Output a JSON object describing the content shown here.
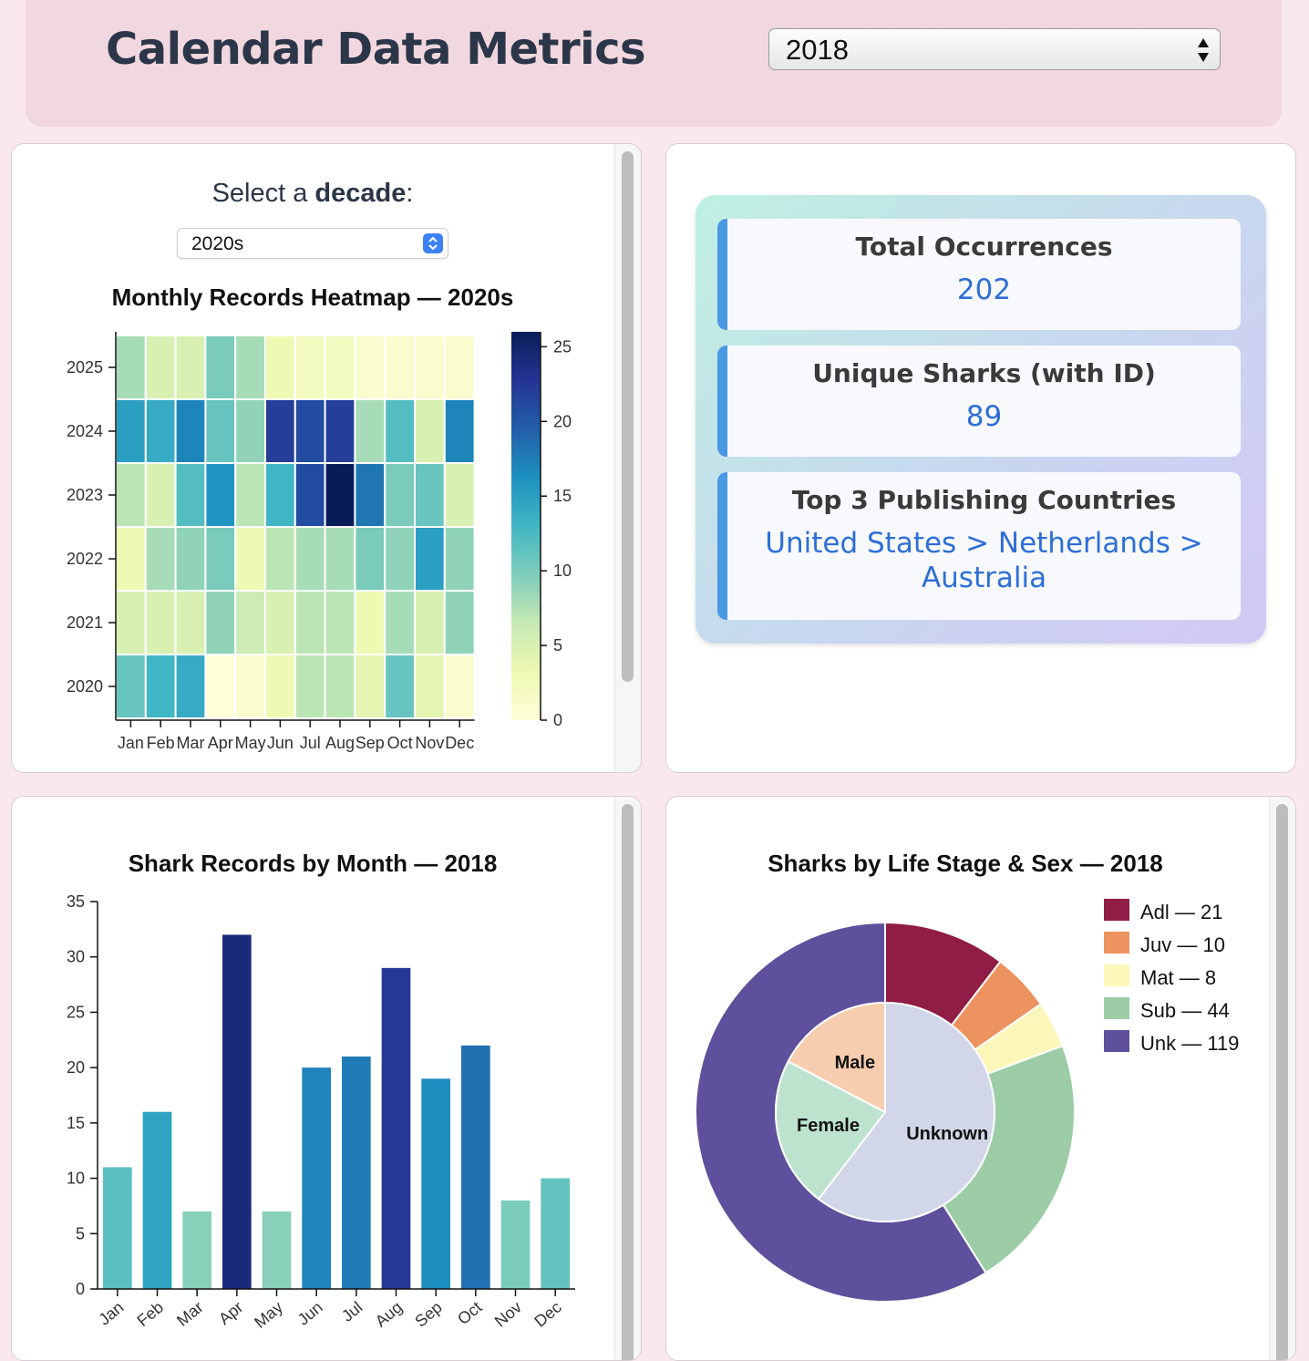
{
  "header": {
    "title": "Calendar Data Metrics",
    "year_select": {
      "value": "2018"
    }
  },
  "heatmap_panel": {
    "decade_label_prefix": "Select a ",
    "decade_label_bold": "decade",
    "decade_label_suffix": ":",
    "decade_select": {
      "value": "2020s"
    }
  },
  "metrics": {
    "total_occurrences": {
      "label": "Total Occurrences",
      "value": "202"
    },
    "unique_sharks": {
      "label": "Unique Sharks (with ID)",
      "value": "89"
    },
    "top_countries": {
      "label": "Top 3 Publishing Countries",
      "value_line1": "United States > Netherlands >",
      "value_line2": "Australia"
    }
  },
  "colors": {
    "accent_blue": "#4a97e4",
    "metric_value": "#2e6fd6",
    "header_bg": "#f1d7df",
    "page_bg": "#f9e8ee"
  },
  "chart_data": [
    {
      "type": "heatmap",
      "title": "Monthly Records Heatmap — 2020s",
      "x_categories": [
        "Jan",
        "Feb",
        "Mar",
        "Apr",
        "May",
        "Jun",
        "Jul",
        "Aug",
        "Sep",
        "Oct",
        "Nov",
        "Dec"
      ],
      "y_categories": [
        "2025",
        "2024",
        "2023",
        "2022",
        "2021",
        "2020"
      ],
      "values": [
        [
          8,
          5,
          5,
          10,
          8,
          3,
          2,
          2,
          1,
          1,
          1,
          1
        ],
        [
          15,
          14,
          17,
          11,
          9,
          22,
          21,
          22,
          8,
          12,
          5,
          17
        ],
        [
          7,
          5,
          12,
          16,
          7,
          13,
          21,
          26,
          18,
          10,
          11,
          5
        ],
        [
          3,
          8,
          9,
          10,
          3,
          7,
          8,
          8,
          10,
          9,
          15,
          9
        ],
        [
          5,
          5,
          5,
          9,
          6,
          5,
          7,
          7,
          3,
          8,
          5,
          9
        ],
        [
          11,
          13,
          14,
          0,
          1,
          3,
          7,
          7,
          4,
          11,
          4,
          1
        ]
      ],
      "colorscale_range": [
        0,
        26
      ],
      "colorbar_ticks": [
        0,
        5,
        10,
        15,
        20,
        25
      ]
    },
    {
      "type": "bar",
      "title": "Shark Records by Month — 2018",
      "categories": [
        "Jan",
        "Feb",
        "Mar",
        "Apr",
        "May",
        "Jun",
        "Jul",
        "Aug",
        "Sep",
        "Oct",
        "Nov",
        "Dec"
      ],
      "values": [
        11,
        16,
        7,
        32,
        7,
        20,
        21,
        29,
        19,
        22,
        8,
        10
      ],
      "ylim": [
        0,
        35
      ],
      "y_ticks": [
        0,
        5,
        10,
        15,
        20,
        25,
        30,
        35
      ]
    },
    {
      "type": "pie",
      "title": "Sharks by Life Stage & Sex — 2018",
      "outer_ring": [
        {
          "name": "Adl",
          "value": 21,
          "color": "#8f1d45",
          "legend": "Adl — 21"
        },
        {
          "name": "Juv",
          "value": 10,
          "color": "#ec935f",
          "legend": "Juv — 10"
        },
        {
          "name": "Mat",
          "value": 8,
          "color": "#fbf7b9",
          "legend": "Mat — 8"
        },
        {
          "name": "Sub",
          "value": 44,
          "color": "#9ccda6",
          "legend": "Sub — 44"
        },
        {
          "name": "Unk",
          "value": 119,
          "color": "#5e509c",
          "legend": "Unk — 119"
        }
      ],
      "inner_ring": [
        {
          "name": "Unknown",
          "value": 122,
          "color": "#d1d6e8"
        },
        {
          "name": "Female",
          "value": 45,
          "color": "#bde3cf"
        },
        {
          "name": "Male",
          "value": 35,
          "color": "#f6cdae"
        }
      ]
    }
  ]
}
